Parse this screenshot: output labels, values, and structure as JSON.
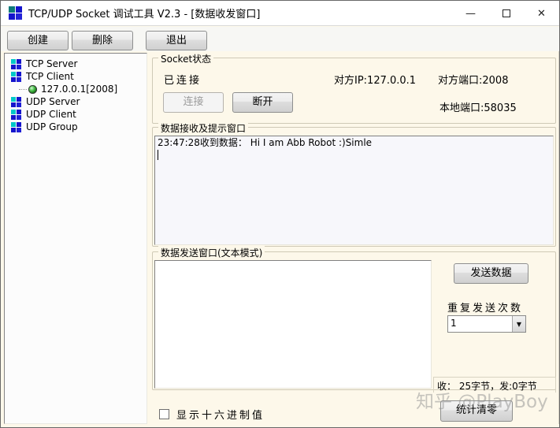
{
  "window": {
    "title": "TCP/UDP Socket 调试工具 V2.3 - [数据收发窗口]",
    "controls": {
      "minimize": "—",
      "close": "✕"
    }
  },
  "toolbar": {
    "create_label": "创建",
    "delete_label": "删除",
    "exit_label": "退出"
  },
  "tree": {
    "items": [
      {
        "label": "TCP Server"
      },
      {
        "label": "TCP Client"
      },
      {
        "label": "127.0.0.1[2008]"
      },
      {
        "label": "UDP Server"
      },
      {
        "label": "UDP Client"
      },
      {
        "label": "UDP Group"
      }
    ]
  },
  "socket_status": {
    "group_title": "Socket状态",
    "state": "已连接",
    "peer_ip": "对方IP:127.0.0.1",
    "peer_port": "对方端口:2008",
    "local_port": "本地端口:58035",
    "connect_label": "连接",
    "disconnect_label": "断开"
  },
  "receive": {
    "group_title": "数据接收及提示窗口",
    "content": "23:47:28收到数据： Hi I am Abb Robot :)Simle"
  },
  "send": {
    "group_title": "数据发送窗口(文本模式)",
    "text_value": "",
    "send_label": "发送数据",
    "repeat_label": "重复发送次数",
    "repeat_value": "1",
    "stats": "收： 25字节，发:0字节"
  },
  "bottom": {
    "hex_label": "显示十六进制值",
    "clear_label": "统计清零"
  },
  "watermark": "知乎 @PlayBoy",
  "colors": {
    "panel_bg": "#fdf8ea",
    "titlebar_bg": "#ffffff",
    "icon_teal": "#0e7a7a",
    "icon_cyan": "#00c8c8",
    "icon_blue": "#1414cc",
    "connected_green": "#157a15",
    "recv_box_bg": "#f7f7fb"
  }
}
